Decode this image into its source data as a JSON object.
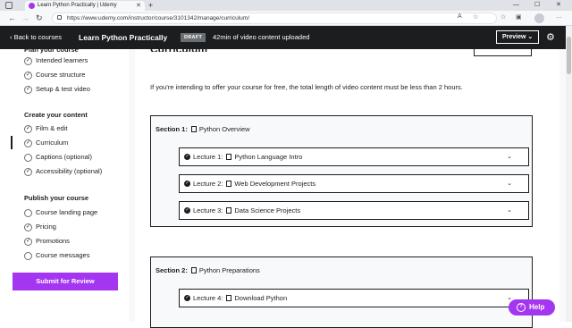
{
  "browser": {
    "tab_title": "Learn Python Practically | Udemy",
    "tab_close": "✕",
    "new_tab": "+",
    "url": "https://www.udemy.com/instructor/course/3101342/manage/curriculum/",
    "win_min": "—",
    "win_max": "☐",
    "win_close": "✕"
  },
  "header": {
    "back_label": "‹  Back to courses",
    "course_title": "Learn Python Practically",
    "status_badge": "DRAFT",
    "uploaded_text": "42min of video content uploaded",
    "preview_label": "Preview  ⌄",
    "settings_icon": "gear-icon"
  },
  "sidebar": {
    "cut_heading": "Plan your course",
    "plan_items": [
      {
        "label": "Intended learners"
      },
      {
        "label": "Course structure"
      },
      {
        "label": "Setup & test video"
      }
    ],
    "create_heading": "Create your content",
    "create_items": [
      {
        "label": "Film & edit"
      },
      {
        "label": "Curriculum"
      },
      {
        "label": "Captions (optional)"
      },
      {
        "label": "Accessibility (optional)"
      }
    ],
    "publish_heading": "Publish your course",
    "publish_items": [
      {
        "label": "Course landing page"
      },
      {
        "label": "Pricing"
      },
      {
        "label": "Promotions"
      },
      {
        "label": "Course messages"
      }
    ],
    "check_glyph": "✓",
    "submit_label": "Submit for Review"
  },
  "main": {
    "cut_title": "Curriculum",
    "info_text": "If you're intending to offer your course for free, the total length of video content must be less than 2 hours.",
    "sections": [
      {
        "label": "Section 1:",
        "title": "Python Overview",
        "lectures": [
          {
            "label": "Lecture 1:",
            "title": "Python Language Intro"
          },
          {
            "label": "Lecture 2:",
            "title": "Web Development Projects"
          },
          {
            "label": "Lecture 3:",
            "title": "Data Science Projects"
          }
        ]
      },
      {
        "label": "Section 2:",
        "title": "Python Preparations",
        "lectures": [
          {
            "label": "Lecture 4:",
            "title": "Download Python"
          }
        ]
      }
    ],
    "chevron": "⌄",
    "lecture_check": "✓"
  },
  "help": {
    "label": "Help",
    "icon_glyph": "?"
  },
  "colors": {
    "brand_purple": "#a435f0",
    "header_dark": "#1c1d1f"
  }
}
